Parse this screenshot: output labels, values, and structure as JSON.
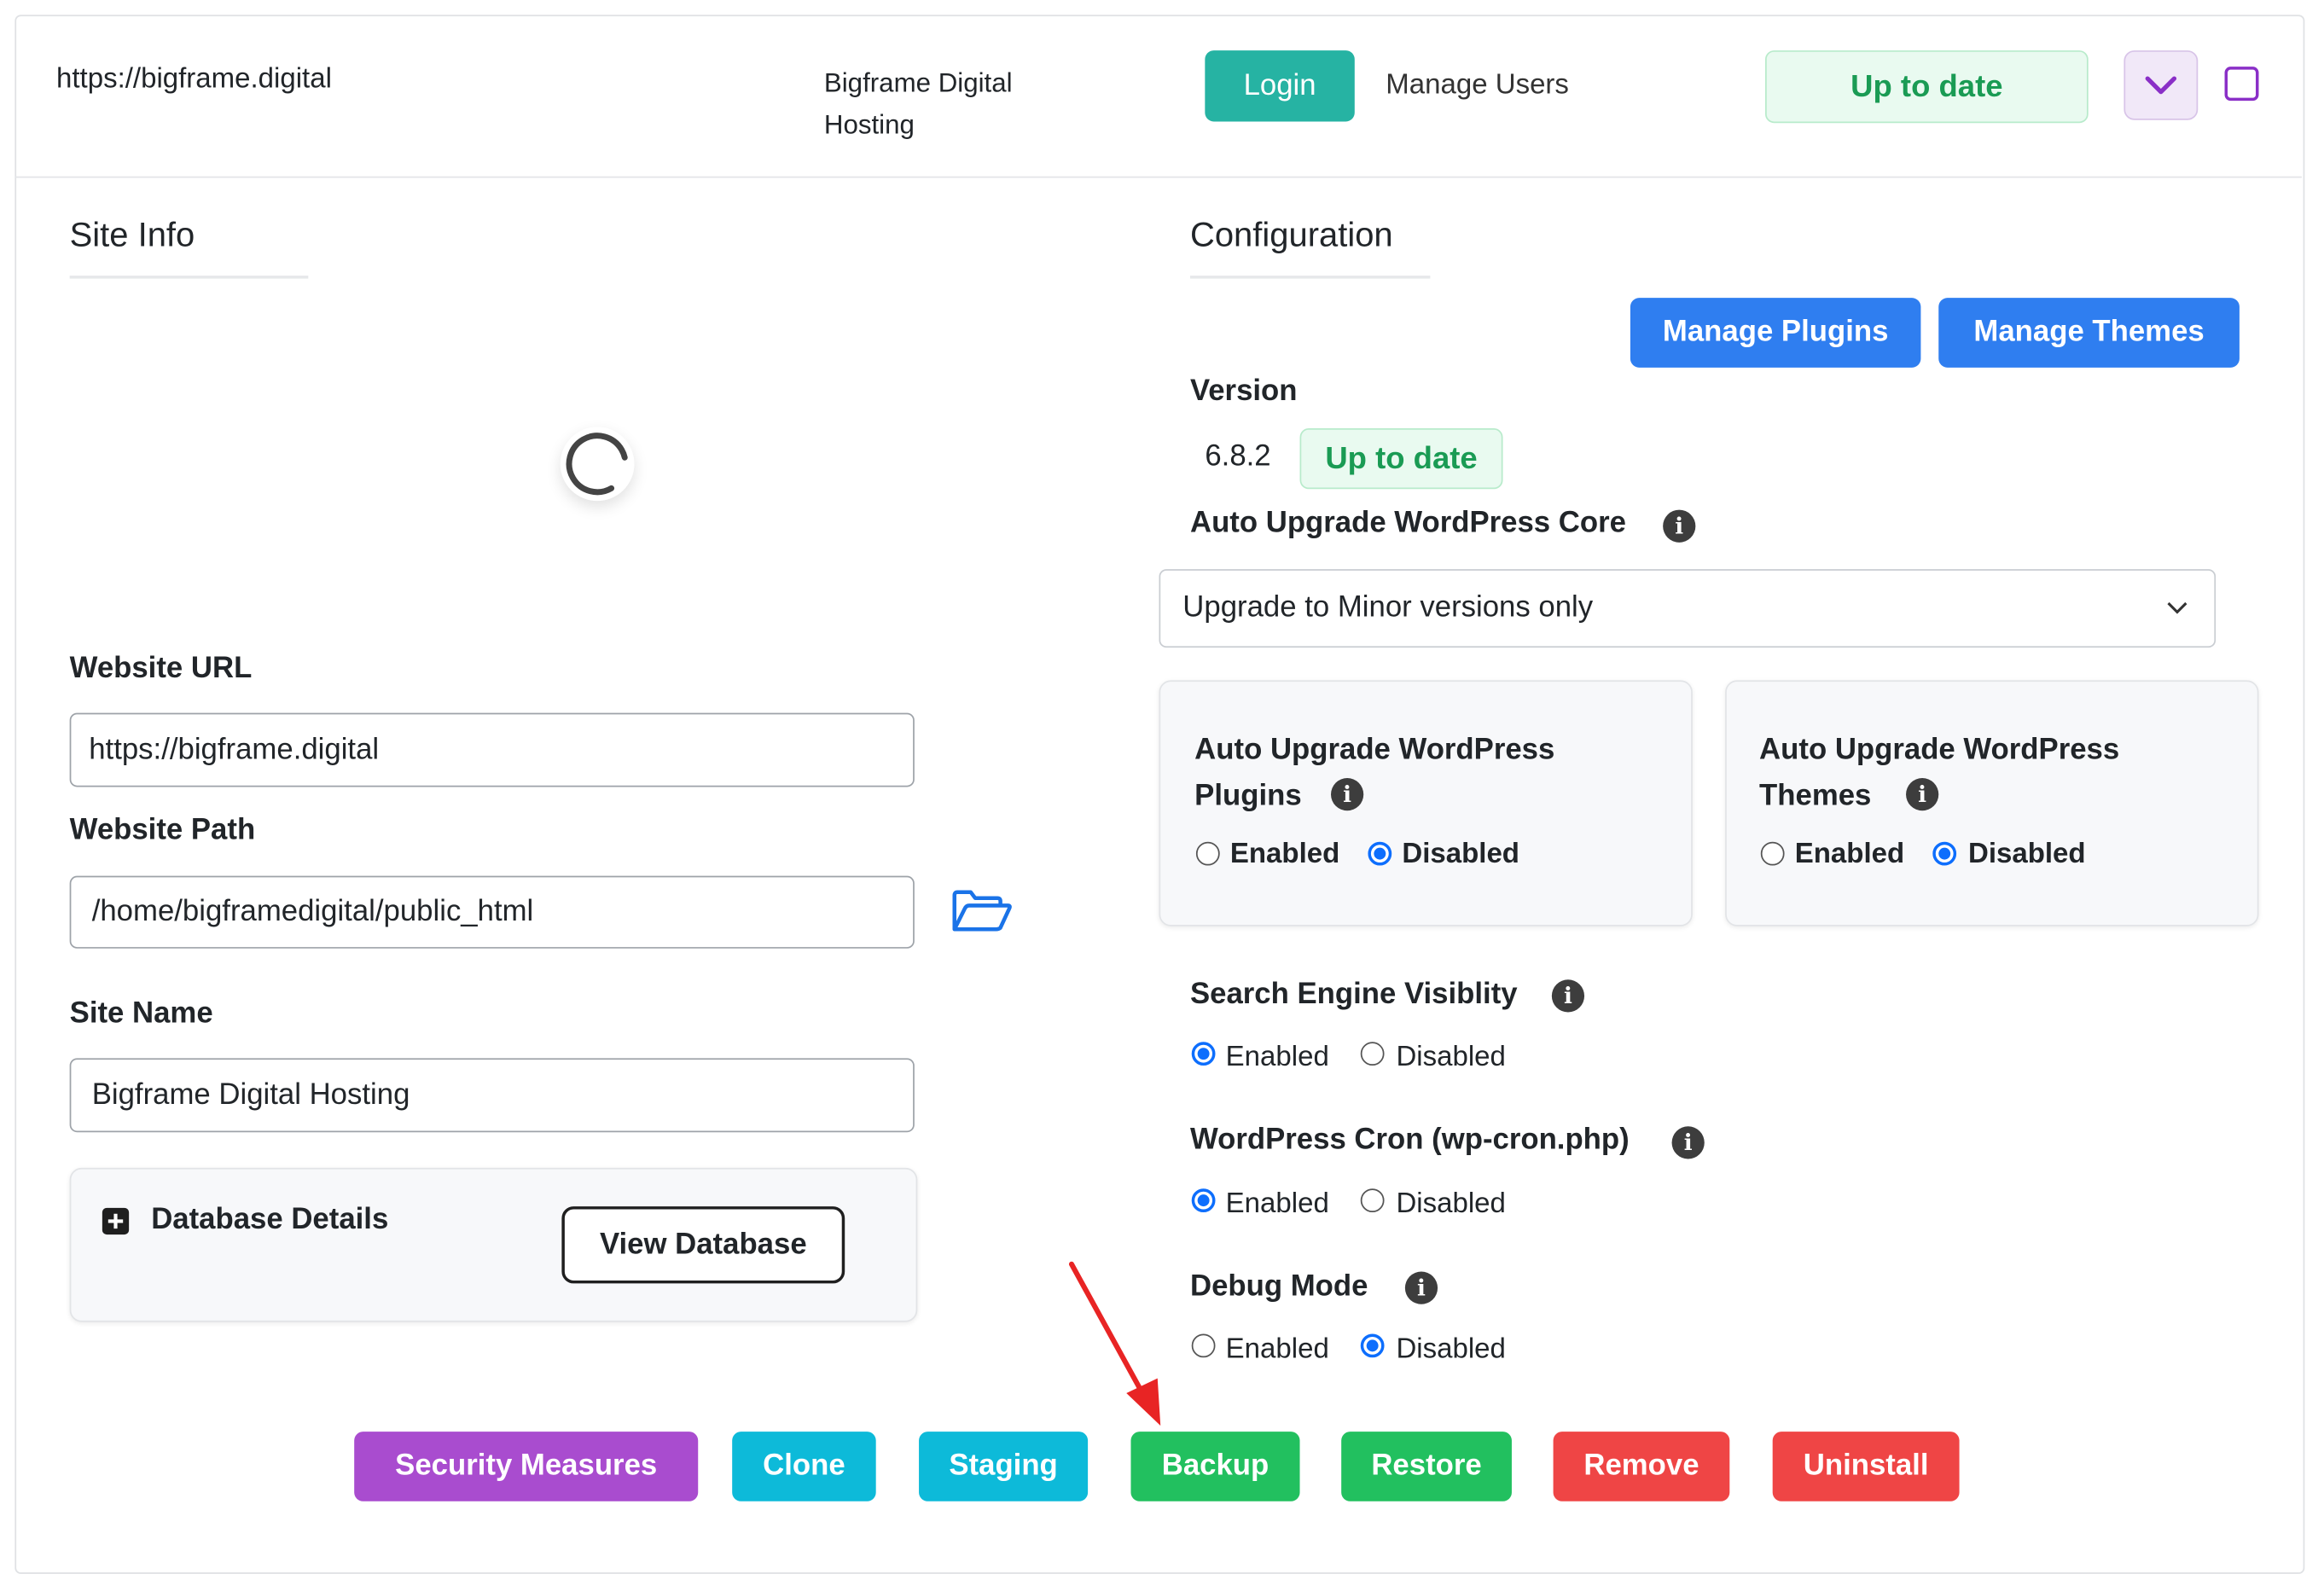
{
  "header": {
    "site_url": "https://bigframe.digital",
    "site_name_line1": "Bigframe Digital",
    "site_name_line2": "Hosting",
    "login_label": "Login",
    "manage_users_label": "Manage Users",
    "status_label": "Up to date"
  },
  "site_info": {
    "tab_title": "Site Info",
    "website_url_label": "Website URL",
    "website_url_value": "https://bigframe.digital",
    "website_path_label": "Website Path",
    "website_path_value": "/home/bigframedigital/public_html",
    "site_name_label": "Site Name",
    "site_name_value": "Bigframe Digital Hosting",
    "database_details_label": "Database Details",
    "view_database_label": "View Database"
  },
  "configuration": {
    "tab_title": "Configuration",
    "manage_plugins_label": "Manage Plugins",
    "manage_themes_label": "Manage Themes",
    "version_label": "Version",
    "version_value": "6.8.2",
    "version_status": "Up to date",
    "auto_upgrade_core_label": "Auto Upgrade WordPress Core",
    "auto_upgrade_core_value": "Upgrade to Minor versions only",
    "plugins_card": {
      "title_line1": "Auto Upgrade WordPress",
      "title_line2": "Plugins",
      "enabled": "Enabled",
      "disabled": "Disabled",
      "selected": "Disabled"
    },
    "themes_card": {
      "title_line1": "Auto Upgrade WordPress",
      "title_line2": "Themes",
      "enabled": "Enabled",
      "disabled": "Disabled",
      "selected": "Disabled"
    },
    "search_engine": {
      "label": "Search Engine Visiblity",
      "enabled": "Enabled",
      "disabled": "Disabled",
      "selected": "Enabled"
    },
    "cron": {
      "label": "WordPress Cron (wp-cron.php)",
      "enabled": "Enabled",
      "disabled": "Disabled",
      "selected": "Enabled"
    },
    "debug": {
      "label": "Debug Mode",
      "enabled": "Enabled",
      "disabled": "Disabled",
      "selected": "Disabled"
    }
  },
  "actions": [
    {
      "label": "Security Measures",
      "color": "#a94ccf"
    },
    {
      "label": "Clone",
      "color": "#0dbad9"
    },
    {
      "label": "Staging",
      "color": "#0dbad9"
    },
    {
      "label": "Backup",
      "color": "#22c05f"
    },
    {
      "label": "Restore",
      "color": "#22c05f"
    },
    {
      "label": "Remove",
      "color": "#ef4545"
    },
    {
      "label": "Uninstall",
      "color": "#ef4545"
    }
  ],
  "colors": {
    "teal": "#26b3a3",
    "blue": "#2f7ef0",
    "purple": "#8a2fc7",
    "annotation_red": "#e82424"
  },
  "icons": {
    "chevron": "chevron-down-icon",
    "folder": "folder-open-icon",
    "plus": "plus-square-icon",
    "info": "info-icon",
    "spinner": "loading-spinner-icon",
    "arrow": "annotation-arrow-icon"
  }
}
